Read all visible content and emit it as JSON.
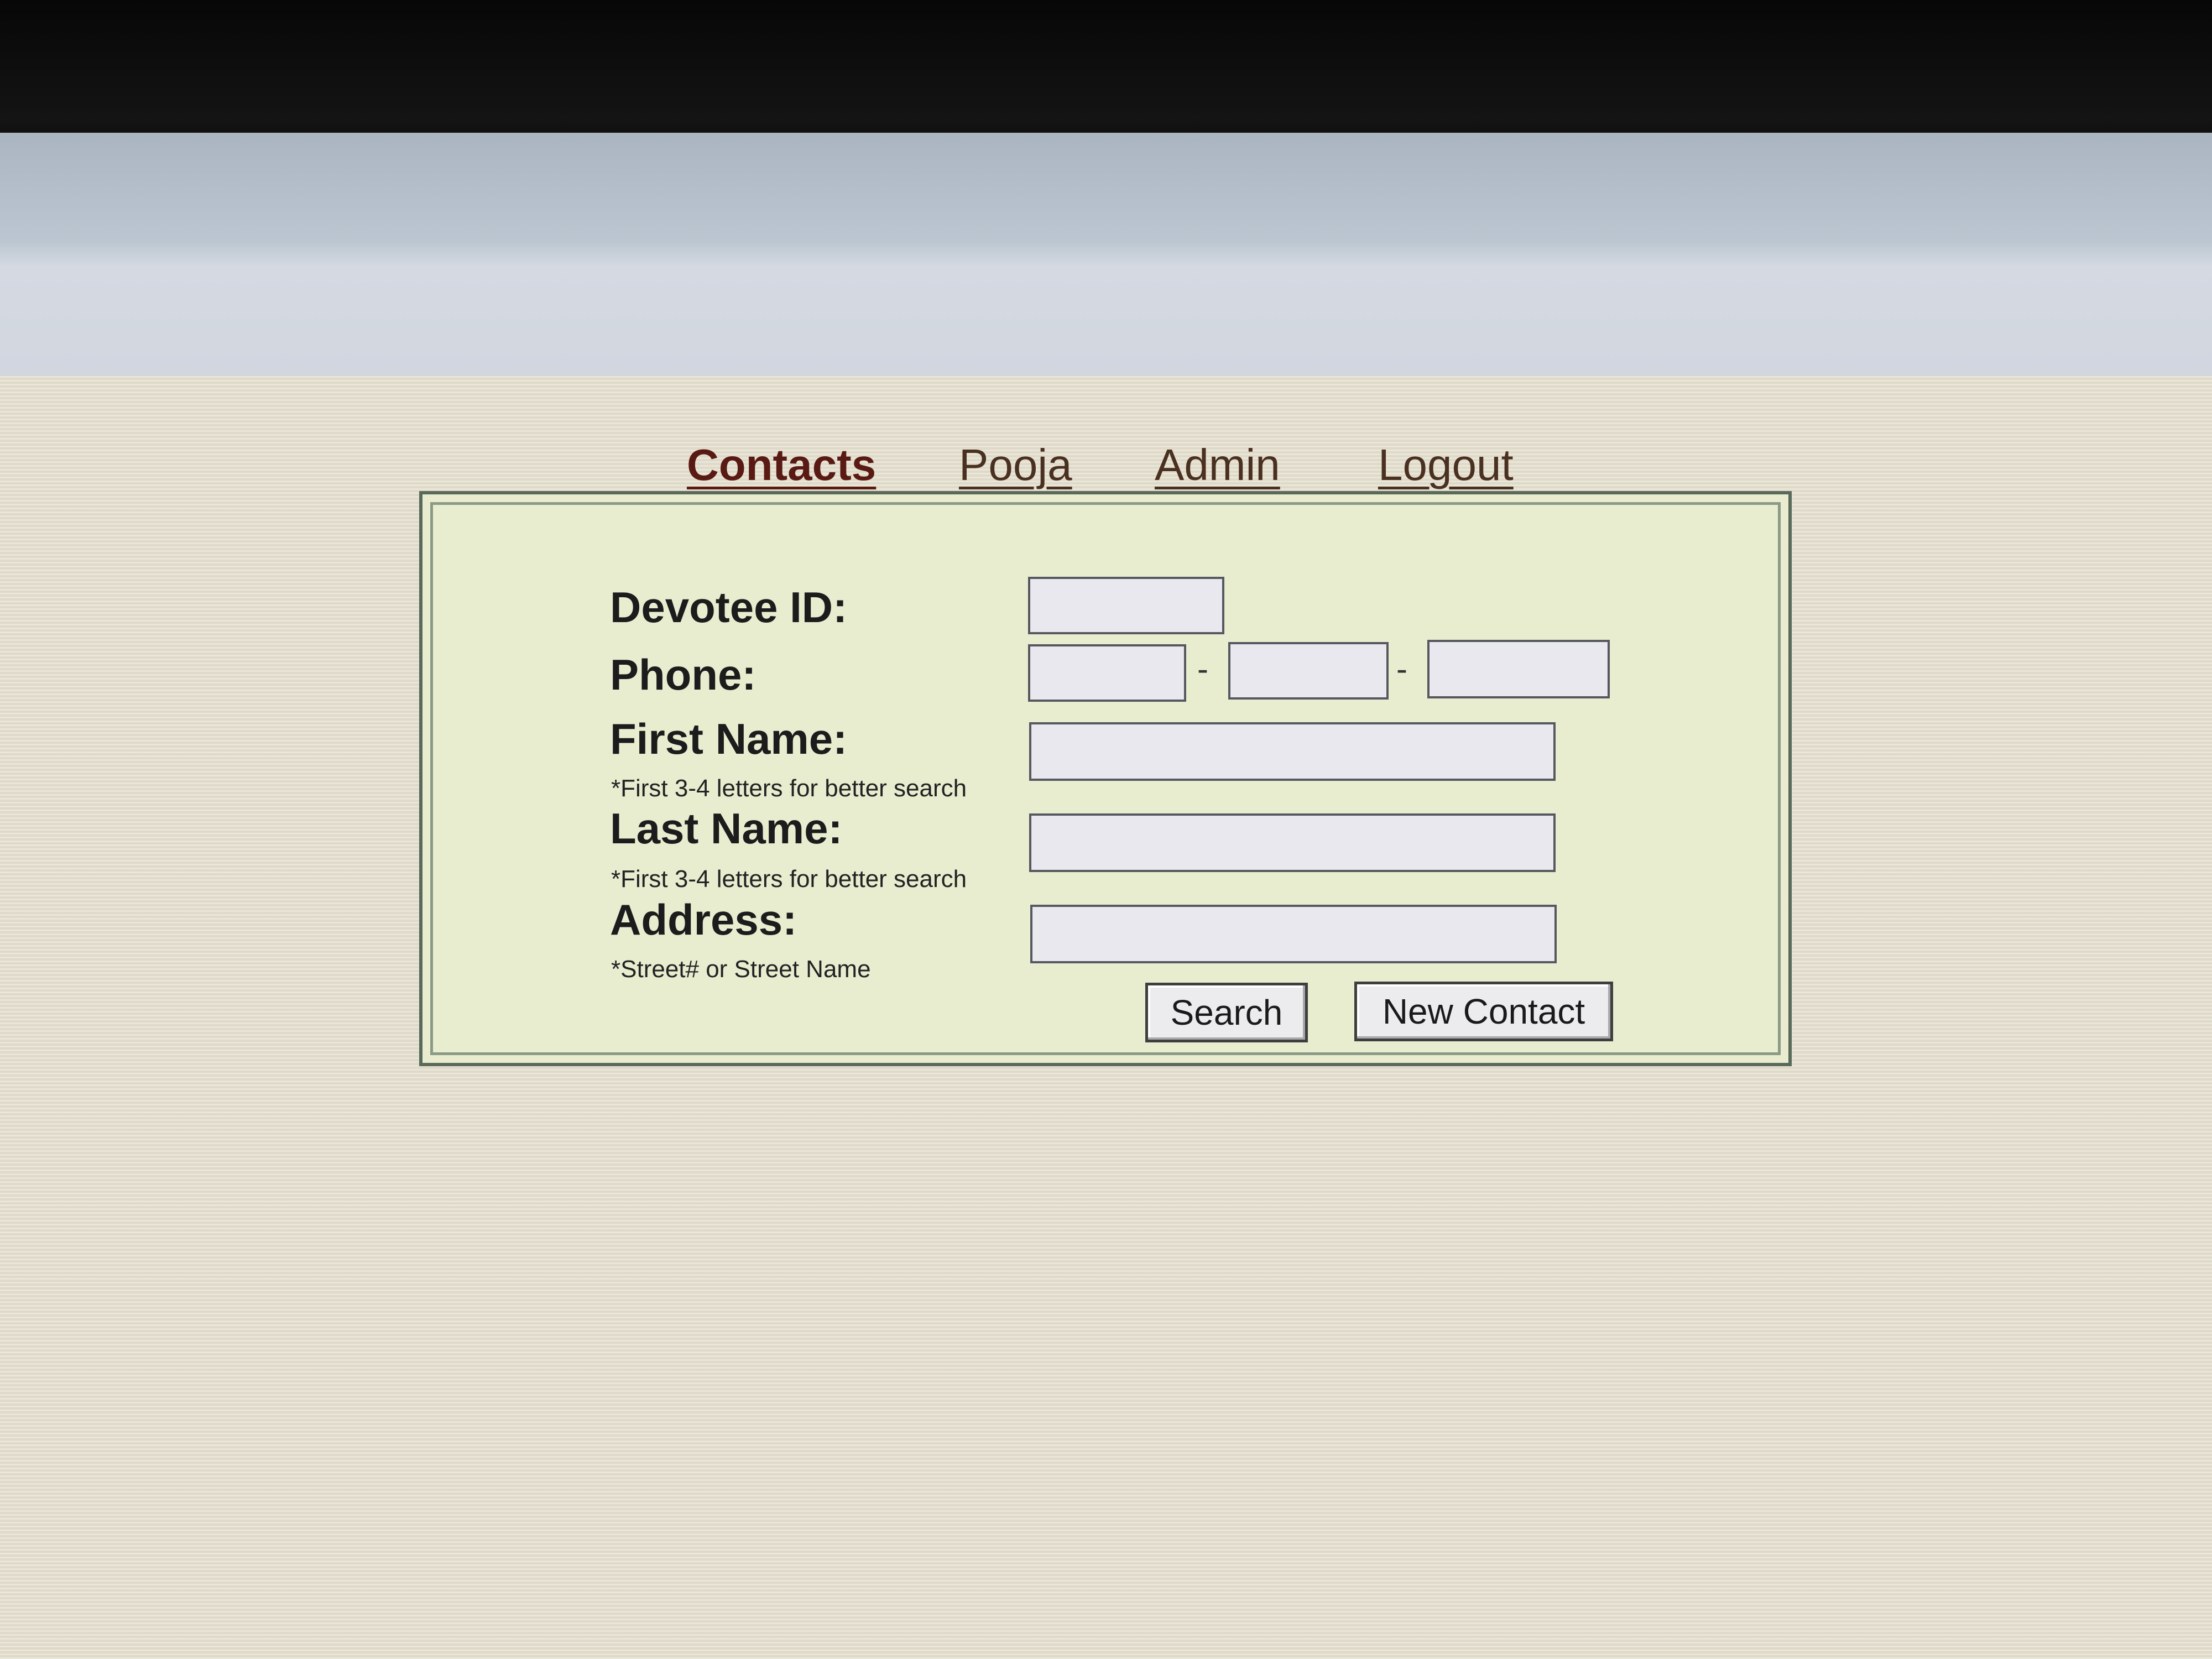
{
  "nav": {
    "contacts": "Contacts",
    "pooja": "Pooja",
    "admin": "Admin",
    "logout": "Logout"
  },
  "form": {
    "devotee_id_label": "Devotee ID:",
    "devotee_id_value": "",
    "phone_label": "Phone:",
    "phone_part1": "",
    "phone_part2": "",
    "phone_part3": "",
    "phone_separator": "-",
    "first_name_label": "First Name:",
    "first_name_hint": "*First 3-4 letters for better search",
    "first_name_value": "",
    "last_name_label": "Last Name:",
    "last_name_hint": "*First 3-4 letters for better search",
    "last_name_value": "",
    "address_label": "Address:",
    "address_hint": "*Street# or Street Name",
    "address_value": ""
  },
  "buttons": {
    "search": "Search",
    "new_contact": "New Contact"
  },
  "colors": {
    "active_link": "#5a1a14",
    "panel_background": "#e8edd0",
    "page_background": "#e6e1cf"
  }
}
